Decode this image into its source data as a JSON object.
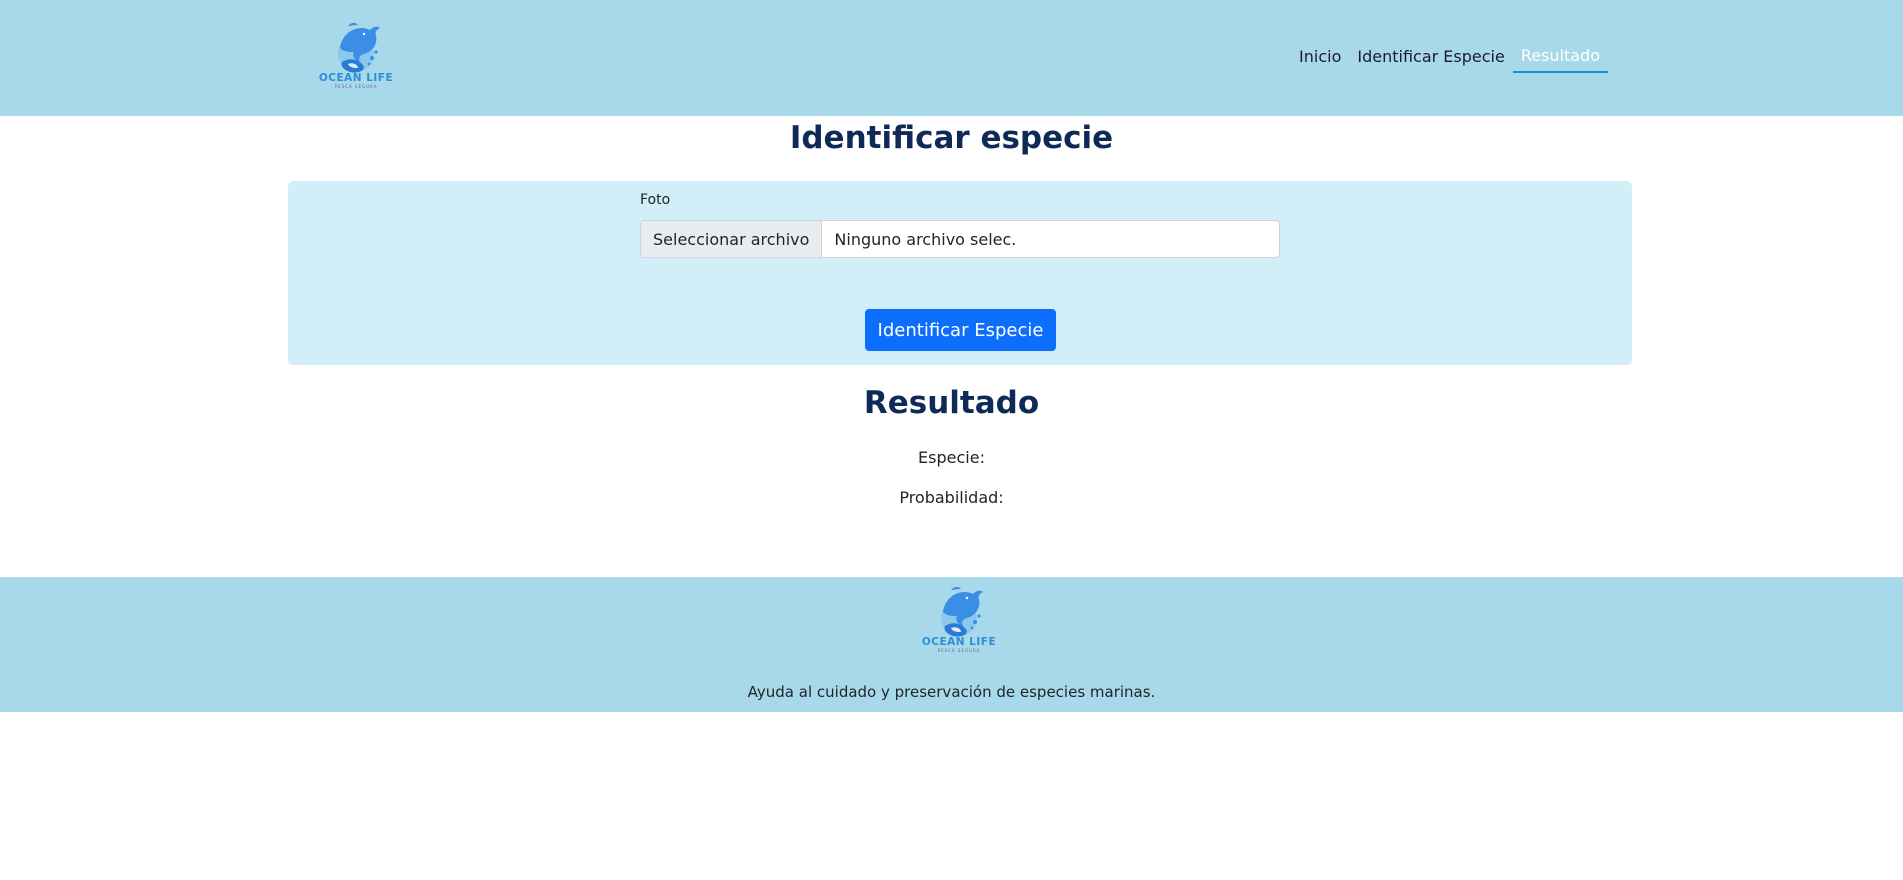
{
  "brand": {
    "name": "OCEAN LIFE",
    "tagline": "PESCA SEGURA",
    "name_color": "#2a8fd6",
    "dolphin_color": "#3b8ee6"
  },
  "nav": {
    "items": [
      {
        "label": "Inicio"
      },
      {
        "label": "Identificar Especie"
      },
      {
        "label": "Resultado",
        "active": true
      }
    ]
  },
  "main": {
    "title": "Identificar especie",
    "form": {
      "photo_label": "Foto",
      "file_button_label": "Seleccionar archivo",
      "file_status": "Ninguno archivo selec.",
      "submit_label": "Identificar Especie"
    },
    "result": {
      "title": "Resultado",
      "species_label": "Especie:",
      "probability_label": "Probabilidad:"
    }
  },
  "footer": {
    "text": "Ayuda al cuidado y preservación de especies marinas."
  },
  "colors": {
    "header_bg": "#a8d9eb",
    "panel_bg": "#d2eef8",
    "title": "#0f2a57",
    "primary_button": "#0d6efd",
    "nav_active_underline": "#1a8cd8"
  }
}
